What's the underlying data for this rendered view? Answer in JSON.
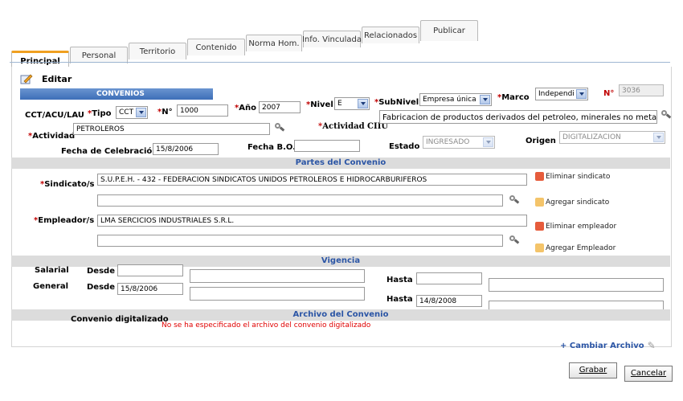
{
  "tabs": [
    "Principal",
    "Personal",
    "Territorio",
    "Contenido",
    "Norma Hom.",
    "Info. Vinculada",
    "Relacionados",
    "Publicar"
  ],
  "header": {
    "title": "Editar",
    "banner": "CONVENIOS"
  },
  "form": {
    "cct_label": "CCT/ACU/LAU",
    "tipo_label": "Tipo",
    "tipo_value": "CCT",
    "n_label": "N°",
    "n_value": "1000",
    "ano_label": "Año",
    "ano_value": "2007",
    "nivel_label": "Nivel",
    "nivel_value": "E",
    "subnivel_label": "SubNivel",
    "subnivel_value": "Empresa única",
    "marco_label": "Marco",
    "marco_value": "Independi",
    "n2_label": "N°",
    "n2_value": "3036",
    "actividad_label": "Actividad",
    "actividad_value": "PETROLEROS",
    "actividad_ciiu_label": "Actividad CIIU",
    "actividad_ciiu_value": "Fabricacion de productos derivados del petroleo, minerales no metalicos y metales",
    "fecha_celebracion_label": "Fecha de Celebración",
    "fecha_celebracion_value": "15/8/2006",
    "fecha_bo_label": "Fecha B.O.",
    "fecha_bo_value": "",
    "estado_label": "Estado",
    "estado_value": "INGRESADO",
    "origen_label": "Origen",
    "origen_value": "DIGITALIZACION"
  },
  "partes": {
    "header": "Partes del Convenio",
    "sindicato_label": "Sindicato/s",
    "sindicato_value": "S.U.P.E.H. - 432 - FEDERACION SINDICATOS UNIDOS PETROLEROS E HIDROCARBURIFEROS",
    "eliminar_sindicato": "Eliminar sindicato",
    "agregar_sindicato": "Agregar sindicato",
    "empleador_label": "Empleador/s",
    "empleador_value": "LMA SERCICIOS INDUSTRIALES S.R.L.",
    "eliminar_empleador": "Eliminar empleador",
    "agregar_empleador": "Agregar Empleador"
  },
  "vigencia": {
    "header": "Vigencia",
    "salarial_label": "Salarial",
    "general_label": "General",
    "desde_label": "Desde",
    "hasta_label": "Hasta",
    "salarial_desde": "",
    "salarial_hasta": "",
    "general_desde": "15/8/2006",
    "general_hasta": "14/8/2008"
  },
  "archivo": {
    "header": "Archivo del Convenio",
    "label": "Convenio digitalizado",
    "status": "No se ha especificado el archivo del convenio digitalizado",
    "cambiar": "+ Cambiar Archivo"
  },
  "buttons": {
    "grabar": "Grabar",
    "cancelar": "Cancelar"
  },
  "colors": {
    "accent": "#2b55a5",
    "required": "#c00000",
    "status_error": "#e00000",
    "tab_active": "#f0a020"
  }
}
